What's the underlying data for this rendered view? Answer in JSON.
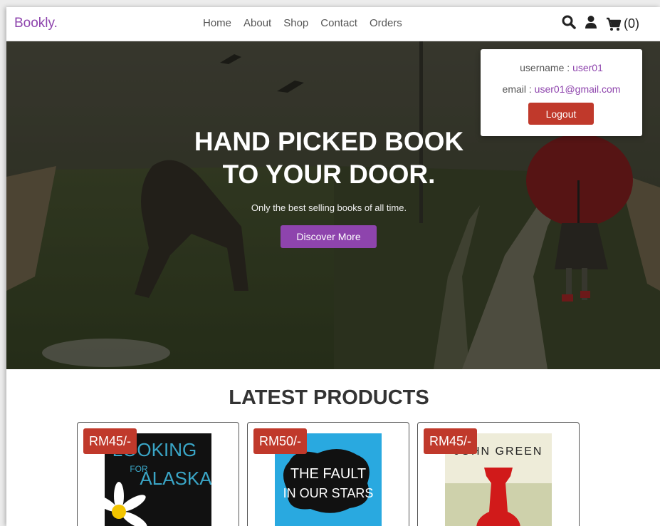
{
  "header": {
    "logo": "Bookly.",
    "nav": [
      "Home",
      "About",
      "Shop",
      "Contact",
      "Orders"
    ],
    "cart_count": "(0)"
  },
  "user_box": {
    "username_label": "username : ",
    "username": "user01",
    "email_label": "email : ",
    "email": "user01@gmail.com",
    "logout_label": "Logout"
  },
  "hero": {
    "title_line1": "HAND PICKED BOOK",
    "title_line2": "TO YOUR DOOR.",
    "subtitle": "Only the best selling books of all time.",
    "button_label": "Discover More"
  },
  "products": {
    "heading": "LATEST PRODUCTS",
    "items": [
      {
        "price": "RM45/-",
        "cover_text_1": "LOOKING",
        "cover_text_2": "ALASKA",
        "cover_text_3": "FOR"
      },
      {
        "price": "RM50/-",
        "cover_text_1": "THE FAULT",
        "cover_text_2": "IN OUR STARS"
      },
      {
        "price": "RM45/-",
        "cover_text_1": "JOHN GREEN"
      }
    ]
  },
  "colors": {
    "accent": "#8e44ad",
    "danger": "#c0392b"
  }
}
